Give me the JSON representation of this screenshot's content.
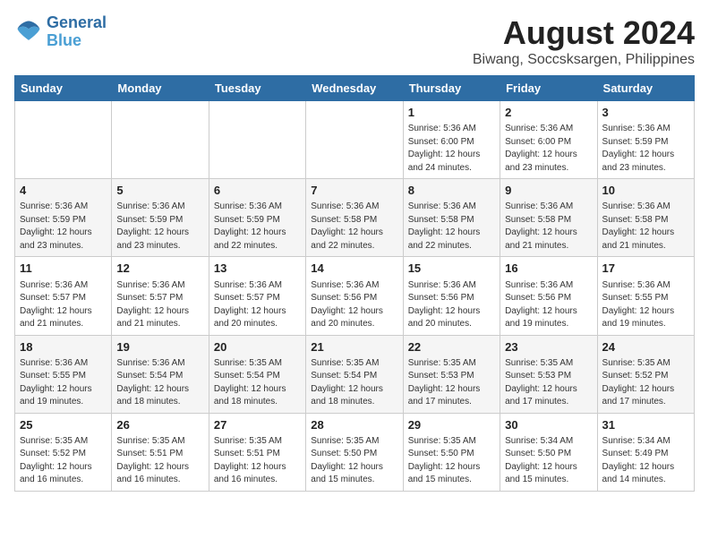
{
  "header": {
    "logo_line1": "General",
    "logo_line2": "Blue",
    "title": "August 2024",
    "subtitle": "Biwang, Soccsksargen, Philippines"
  },
  "days_of_week": [
    "Sunday",
    "Monday",
    "Tuesday",
    "Wednesday",
    "Thursday",
    "Friday",
    "Saturday"
  ],
  "weeks": [
    [
      {
        "day": "",
        "content": ""
      },
      {
        "day": "",
        "content": ""
      },
      {
        "day": "",
        "content": ""
      },
      {
        "day": "",
        "content": ""
      },
      {
        "day": "1",
        "content": "Sunrise: 5:36 AM\nSunset: 6:00 PM\nDaylight: 12 hours\nand 24 minutes."
      },
      {
        "day": "2",
        "content": "Sunrise: 5:36 AM\nSunset: 6:00 PM\nDaylight: 12 hours\nand 23 minutes."
      },
      {
        "day": "3",
        "content": "Sunrise: 5:36 AM\nSunset: 5:59 PM\nDaylight: 12 hours\nand 23 minutes."
      }
    ],
    [
      {
        "day": "4",
        "content": "Sunrise: 5:36 AM\nSunset: 5:59 PM\nDaylight: 12 hours\nand 23 minutes."
      },
      {
        "day": "5",
        "content": "Sunrise: 5:36 AM\nSunset: 5:59 PM\nDaylight: 12 hours\nand 23 minutes."
      },
      {
        "day": "6",
        "content": "Sunrise: 5:36 AM\nSunset: 5:59 PM\nDaylight: 12 hours\nand 22 minutes."
      },
      {
        "day": "7",
        "content": "Sunrise: 5:36 AM\nSunset: 5:58 PM\nDaylight: 12 hours\nand 22 minutes."
      },
      {
        "day": "8",
        "content": "Sunrise: 5:36 AM\nSunset: 5:58 PM\nDaylight: 12 hours\nand 22 minutes."
      },
      {
        "day": "9",
        "content": "Sunrise: 5:36 AM\nSunset: 5:58 PM\nDaylight: 12 hours\nand 21 minutes."
      },
      {
        "day": "10",
        "content": "Sunrise: 5:36 AM\nSunset: 5:58 PM\nDaylight: 12 hours\nand 21 minutes."
      }
    ],
    [
      {
        "day": "11",
        "content": "Sunrise: 5:36 AM\nSunset: 5:57 PM\nDaylight: 12 hours\nand 21 minutes."
      },
      {
        "day": "12",
        "content": "Sunrise: 5:36 AM\nSunset: 5:57 PM\nDaylight: 12 hours\nand 21 minutes."
      },
      {
        "day": "13",
        "content": "Sunrise: 5:36 AM\nSunset: 5:57 PM\nDaylight: 12 hours\nand 20 minutes."
      },
      {
        "day": "14",
        "content": "Sunrise: 5:36 AM\nSunset: 5:56 PM\nDaylight: 12 hours\nand 20 minutes."
      },
      {
        "day": "15",
        "content": "Sunrise: 5:36 AM\nSunset: 5:56 PM\nDaylight: 12 hours\nand 20 minutes."
      },
      {
        "day": "16",
        "content": "Sunrise: 5:36 AM\nSunset: 5:56 PM\nDaylight: 12 hours\nand 19 minutes."
      },
      {
        "day": "17",
        "content": "Sunrise: 5:36 AM\nSunset: 5:55 PM\nDaylight: 12 hours\nand 19 minutes."
      }
    ],
    [
      {
        "day": "18",
        "content": "Sunrise: 5:36 AM\nSunset: 5:55 PM\nDaylight: 12 hours\nand 19 minutes."
      },
      {
        "day": "19",
        "content": "Sunrise: 5:36 AM\nSunset: 5:54 PM\nDaylight: 12 hours\nand 18 minutes."
      },
      {
        "day": "20",
        "content": "Sunrise: 5:35 AM\nSunset: 5:54 PM\nDaylight: 12 hours\nand 18 minutes."
      },
      {
        "day": "21",
        "content": "Sunrise: 5:35 AM\nSunset: 5:54 PM\nDaylight: 12 hours\nand 18 minutes."
      },
      {
        "day": "22",
        "content": "Sunrise: 5:35 AM\nSunset: 5:53 PM\nDaylight: 12 hours\nand 17 minutes."
      },
      {
        "day": "23",
        "content": "Sunrise: 5:35 AM\nSunset: 5:53 PM\nDaylight: 12 hours\nand 17 minutes."
      },
      {
        "day": "24",
        "content": "Sunrise: 5:35 AM\nSunset: 5:52 PM\nDaylight: 12 hours\nand 17 minutes."
      }
    ],
    [
      {
        "day": "25",
        "content": "Sunrise: 5:35 AM\nSunset: 5:52 PM\nDaylight: 12 hours\nand 16 minutes."
      },
      {
        "day": "26",
        "content": "Sunrise: 5:35 AM\nSunset: 5:51 PM\nDaylight: 12 hours\nand 16 minutes."
      },
      {
        "day": "27",
        "content": "Sunrise: 5:35 AM\nSunset: 5:51 PM\nDaylight: 12 hours\nand 16 minutes."
      },
      {
        "day": "28",
        "content": "Sunrise: 5:35 AM\nSunset: 5:50 PM\nDaylight: 12 hours\nand 15 minutes."
      },
      {
        "day": "29",
        "content": "Sunrise: 5:35 AM\nSunset: 5:50 PM\nDaylight: 12 hours\nand 15 minutes."
      },
      {
        "day": "30",
        "content": "Sunrise: 5:34 AM\nSunset: 5:50 PM\nDaylight: 12 hours\nand 15 minutes."
      },
      {
        "day": "31",
        "content": "Sunrise: 5:34 AM\nSunset: 5:49 PM\nDaylight: 12 hours\nand 14 minutes."
      }
    ]
  ]
}
